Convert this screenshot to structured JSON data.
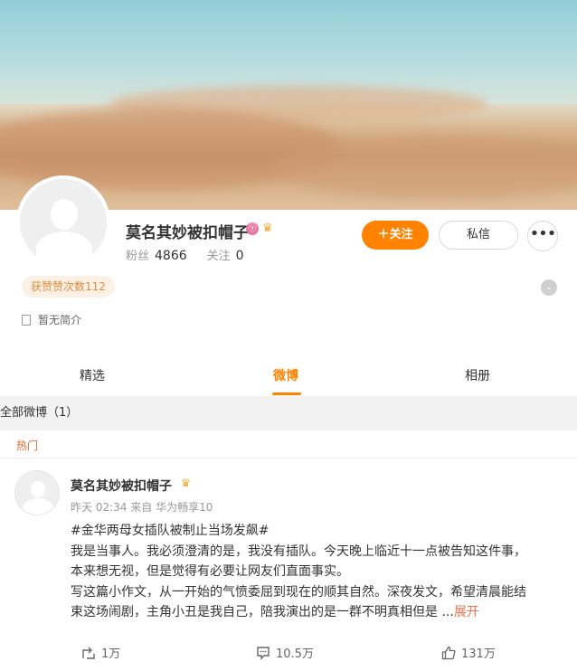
{
  "profile": {
    "name": "莫名其妙被扣帽子",
    "fans_label": "粉丝",
    "fans_count": "4866",
    "following_label": "关注",
    "following_count": "0",
    "follow_button": "关注",
    "message_button": "私信",
    "likes_badge": "获赞赞次数112",
    "bio": "暂无简介"
  },
  "tabs": [
    {
      "label": "精选",
      "active": false
    },
    {
      "label": "微博",
      "active": true
    },
    {
      "label": "相册",
      "active": false
    }
  ],
  "feed": {
    "section_title": "全部微博（1）",
    "hot_label": "热门"
  },
  "post": {
    "author": "莫名其妙被扣帽子",
    "time": "昨天 02:34",
    "source_prefix": "来自",
    "source": "华为畅享10",
    "hashtag": "#金华两母女插队被制止当场发飙#",
    "line1": "我是当事人。我必须澄清的是，我没有插队。今天晚上临近十一点被告知这件事，",
    "line2": "本来想无视，但是觉得有必要让网友们直面事实。",
    "line3": "写这篇小作文，从一开始的气愤委屈到现在的顺其自然。深夜发文，希望清晨能结",
    "line4": "束这场闹剧，主角小丑是我自己，陪我演出的是一群不明真相但是",
    "ellipsis": "...",
    "expand": "展开",
    "reposts": "1万",
    "comments": "10.5万",
    "likes": "131万"
  },
  "colors": {
    "accent": "#ff8200",
    "expand_link": "#eb7350",
    "hot": "#e06b31",
    "crown": "#f0a730"
  },
  "icons": [
    "vip-icon",
    "crown-icon",
    "more-icon",
    "chevron-down-icon",
    "doc-icon",
    "repost-icon",
    "comment-icon",
    "like-icon"
  ]
}
